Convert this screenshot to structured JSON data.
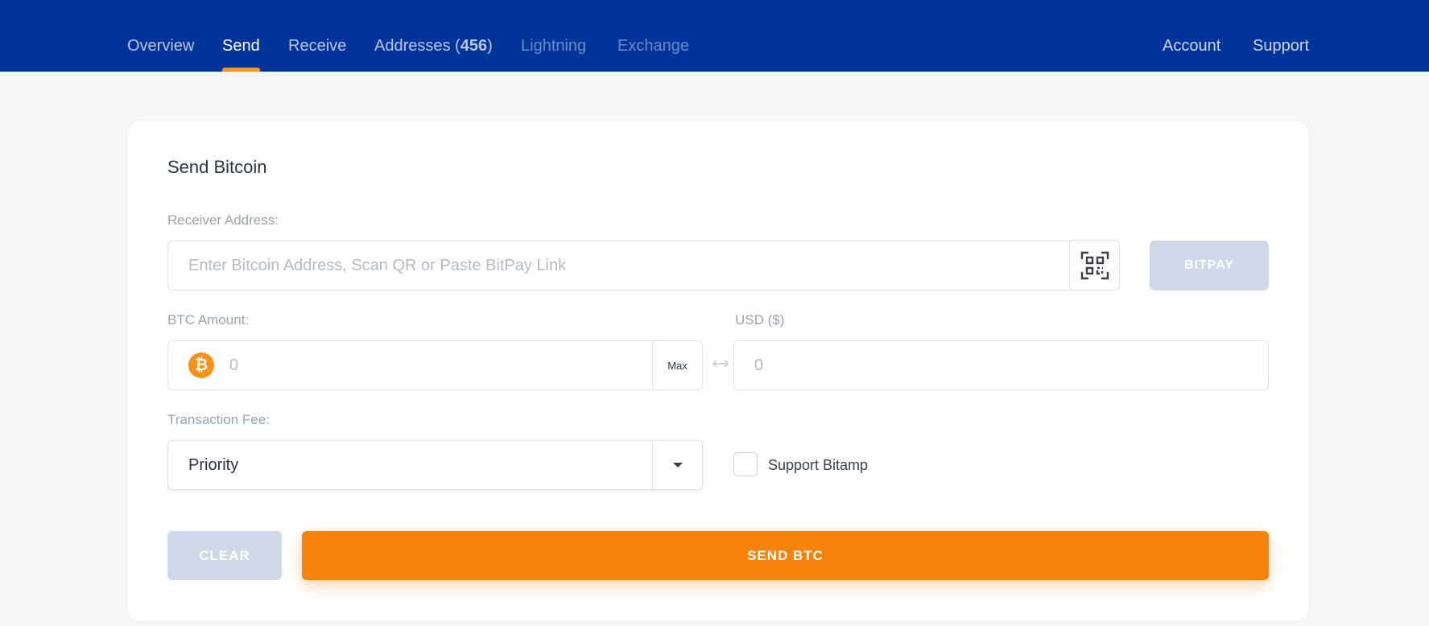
{
  "nav": {
    "left": [
      {
        "label": "Overview",
        "state": "normal"
      },
      {
        "label": "Send",
        "state": "active"
      },
      {
        "label": "Receive",
        "state": "normal"
      },
      {
        "label_prefix": "Addresses (",
        "count": "456",
        "label_suffix": ")",
        "state": "normal"
      },
      {
        "label": "Lightning",
        "state": "disabled"
      },
      {
        "label": "Exchange",
        "state": "disabled"
      }
    ],
    "right": [
      {
        "label": "Account"
      },
      {
        "label": "Support"
      }
    ]
  },
  "send_form": {
    "title": "Send Bitcoin",
    "receiver": {
      "label": "Receiver Address:",
      "placeholder": "Enter Bitcoin Address, Scan QR or Paste BitPay Link",
      "qr_icon": "qr-code-icon",
      "bitpay_button": "BITPAY"
    },
    "btc_amount": {
      "label": "BTC Amount:",
      "coin_symbol": "₿",
      "placeholder": "0",
      "max_button": "Max"
    },
    "swap_icon": "swap-arrows-icon",
    "usd_amount": {
      "label": "USD ($)",
      "placeholder": "0"
    },
    "fee": {
      "label": "Transaction Fee:",
      "selected": "Priority",
      "dropdown_icon": "caret-down-icon"
    },
    "support_checkbox": {
      "label": "Support Bitamp",
      "checked": false
    },
    "clear_button": "CLEAR",
    "send_button": "SEND BTC"
  },
  "colors": {
    "nav_bg": "#00349a",
    "accent_orange": "#f7931a",
    "send_button": "#f8820a",
    "disabled_button": "#cfd9ea",
    "page_bg": "#f4f6f8"
  }
}
